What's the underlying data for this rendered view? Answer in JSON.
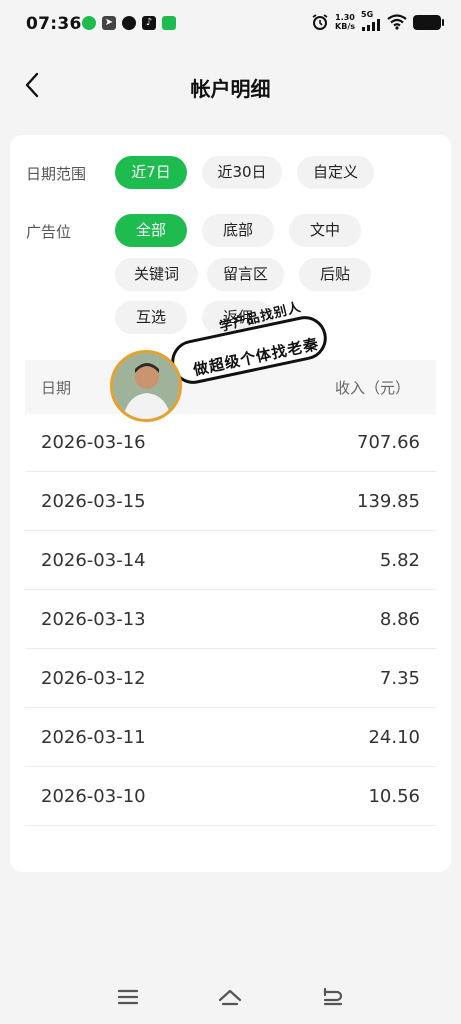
{
  "status_bar": {
    "time": "07:36",
    "net_speed_value": "1.30",
    "net_speed_unit": "KB/s",
    "network_type": "5G",
    "icons": [
      "app-notification-icon",
      "arrow-icon",
      "qq-icon",
      "tiktok-icon",
      "wechat-icon",
      "alarm-icon",
      "signal-icon",
      "wifi-icon",
      "battery-icon"
    ]
  },
  "header": {
    "title": "帐户明细"
  },
  "filters": {
    "date_range_label": "日期范围",
    "date_options": [
      "近7日",
      "近30日",
      "自定义"
    ],
    "date_selected": "近7日",
    "ad_slot_label": "广告位",
    "ad_options": [
      "全部",
      "底部",
      "文中",
      "关键词",
      "留言区",
      "后贴",
      "互选",
      "返佣"
    ],
    "ad_selected": "全部"
  },
  "table": {
    "headers": {
      "date": "日期",
      "income": "收入（元）"
    },
    "rows": [
      {
        "date": "2026-03-16",
        "income": "707.66"
      },
      {
        "date": "2026-03-15",
        "income": "139.85"
      },
      {
        "date": "2026-03-14",
        "income": "5.82"
      },
      {
        "date": "2026-03-13",
        "income": "8.86"
      },
      {
        "date": "2026-03-12",
        "income": "7.35"
      },
      {
        "date": "2026-03-11",
        "income": "24.10"
      },
      {
        "date": "2026-03-10",
        "income": "10.56"
      }
    ]
  },
  "overlay": {
    "line1": "学产品找别人",
    "line2": "做超级个体找老秦"
  },
  "colors": {
    "accent": "#1ebc4f",
    "background": "#f3f4f3",
    "card": "#ffffff"
  },
  "nav_icons": [
    "menu-icon",
    "home-icon",
    "back-nav-icon"
  ]
}
